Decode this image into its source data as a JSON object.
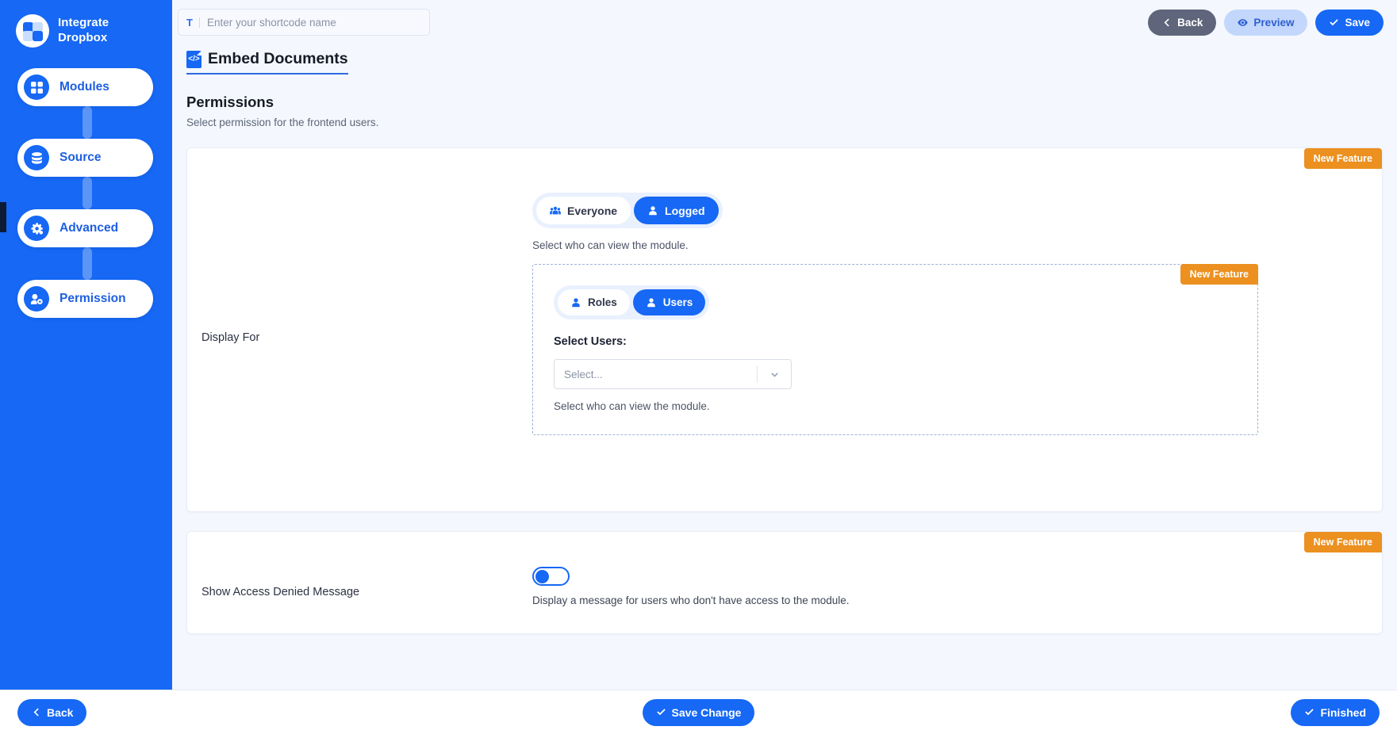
{
  "brand": {
    "line1": "Integrate",
    "line2": "Dropbox",
    "logo_icon": "dropbox-integration-icon"
  },
  "sidebar": {
    "items": [
      {
        "label": "Modules",
        "icon": "grid-icon"
      },
      {
        "label": "Source",
        "icon": "database-icon"
      },
      {
        "label": "Advanced",
        "icon": "gear-icon"
      },
      {
        "label": "Permission",
        "icon": "key-user-icon"
      }
    ]
  },
  "topbar": {
    "shortcode_prefix": "T",
    "shortcode_value": "",
    "shortcode_placeholder": "Enter your shortcode name",
    "back_label": "Back",
    "preview_label": "Preview",
    "save_label": "Save"
  },
  "page": {
    "doc_title": "Embed Documents",
    "doc_icon": "code-document-icon",
    "section_title": "Permissions",
    "section_sub": "Select permission for the frontend users."
  },
  "display_for": {
    "row_label": "Display For",
    "badge": "New Feature",
    "audience": {
      "options": [
        {
          "label": "Everyone",
          "icon": "people-group-icon",
          "selected": false
        },
        {
          "label": "Logged",
          "icon": "user-icon",
          "selected": true
        }
      ],
      "helper": "Select who can view the module."
    },
    "inner": {
      "badge": "New Feature",
      "options": [
        {
          "label": "Roles",
          "icon": "user-icon",
          "selected": false
        },
        {
          "label": "Users",
          "icon": "user-icon",
          "selected": true
        }
      ],
      "field_label": "Select Users:",
      "select_value": "Select...",
      "select_placeholder": "Select...",
      "helper": "Select who can view the module."
    }
  },
  "access_denied": {
    "row_label": "Show Access Denied Message",
    "badge": "New Feature",
    "toggle_on": true,
    "helper": "Display a message for users who don't have access to the module."
  },
  "footer": {
    "back_label": "Back",
    "save_change_label": "Save Change",
    "finished_label": "Finished"
  },
  "colors": {
    "brand_blue": "#1668f5",
    "orange_badge": "#ec9020",
    "dark_button": "#5f657a",
    "light_blue_button": "#c2d7fb",
    "page_bg": "#f4f7fe"
  }
}
